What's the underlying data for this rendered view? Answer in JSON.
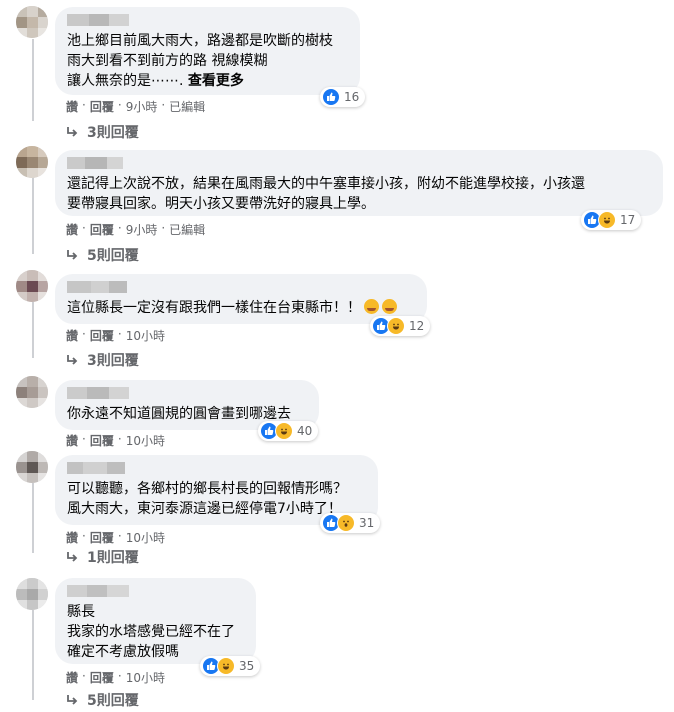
{
  "comments": [
    {
      "text": "池上鄉目前風大雨大，路邊都是吹斷的樹枝\n雨大到看不到前方的路 視線模糊\n讓人無奈的是⋯⋯. ",
      "see_more": "查看更多",
      "reactions": [
        "like"
      ],
      "count": "16",
      "reply": "回覆",
      "time": "9小時",
      "edited": "已編輯",
      "replies": "3則回覆"
    },
    {
      "text": "還記得上次說不放，結果在風雨最大的中午塞車接小孩，附幼不能進學校接，小孩還\n要帶寢具回家。明天小孩又要帶洗好的寢具上學。",
      "reactions": [
        "like",
        "haha"
      ],
      "count": "17",
      "reply": "回覆",
      "time": "9小時",
      "edited": "已編輯",
      "replies": "5則回覆"
    },
    {
      "text": "這位縣長一定沒有跟我們一樣住在台東縣市！！",
      "inline_emoji": [
        "tired-face-emoji",
        "tired-face-emoji"
      ],
      "reactions": [
        "like",
        "haha"
      ],
      "count": "12",
      "reply": "回覆",
      "time": "10小時",
      "replies": "3則回覆"
    },
    {
      "text": "你永遠不知道圓規的圓會畫到哪邊去",
      "reactions": [
        "like",
        "haha"
      ],
      "count": "40",
      "reply": "回覆",
      "time": "10小時"
    },
    {
      "text": "可以聽聽，各鄉村的鄉長村長的回報情形嗎？\n風大雨大，東河泰源這邊已經停電7小時了！",
      "reactions": [
        "like",
        "wow"
      ],
      "count": "31",
      "reply": "回覆",
      "time": "10小時",
      "replies": "1則回覆"
    },
    {
      "text": "縣長\n我家的水塔感覺已經不在了\n確定不考慮放假嗎",
      "reactions": [
        "like",
        "haha"
      ],
      "count": "35",
      "reply": "回覆",
      "time": "10小時",
      "replies": "5則回覆"
    }
  ],
  "read_label": "讚",
  "colors": {
    "like": "#1877f2",
    "haha": "#f7b928",
    "meta": "#65676b",
    "bubble": "#f0f2f5"
  }
}
